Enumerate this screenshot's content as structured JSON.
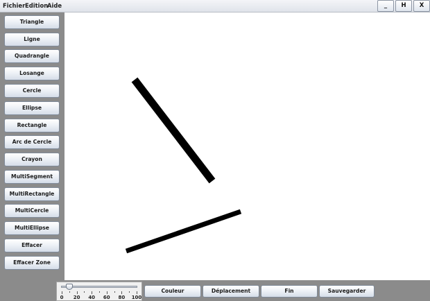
{
  "menubar": {
    "items": [
      "Fichier",
      "Edition",
      "Aide"
    ]
  },
  "window_controls": {
    "minimize": "_",
    "maximize": "H",
    "close": "X"
  },
  "tools": [
    "Triangle",
    "Ligne",
    "Quadrangle",
    "Losange",
    "Cercle",
    "Ellipse",
    "Rectangle",
    "Arc de Cercle",
    "Crayon",
    "MultiSegment",
    "MultiRectangle",
    "MultiCercle",
    "MultiEllipse",
    "Effacer",
    "Effacer Zone"
  ],
  "slider": {
    "value": 10,
    "min": 0,
    "max": 100,
    "tick_labels": [
      "0",
      "20",
      "40",
      "60",
      "80",
      "100"
    ]
  },
  "actions": {
    "color": "Couleur",
    "move": "Déplacement",
    "end": "Fin",
    "save": "Sauvegarder"
  },
  "colors": {
    "stroke": "#000000",
    "canvas_background": "#ffffff",
    "panel_background": "#8b8b8b"
  }
}
